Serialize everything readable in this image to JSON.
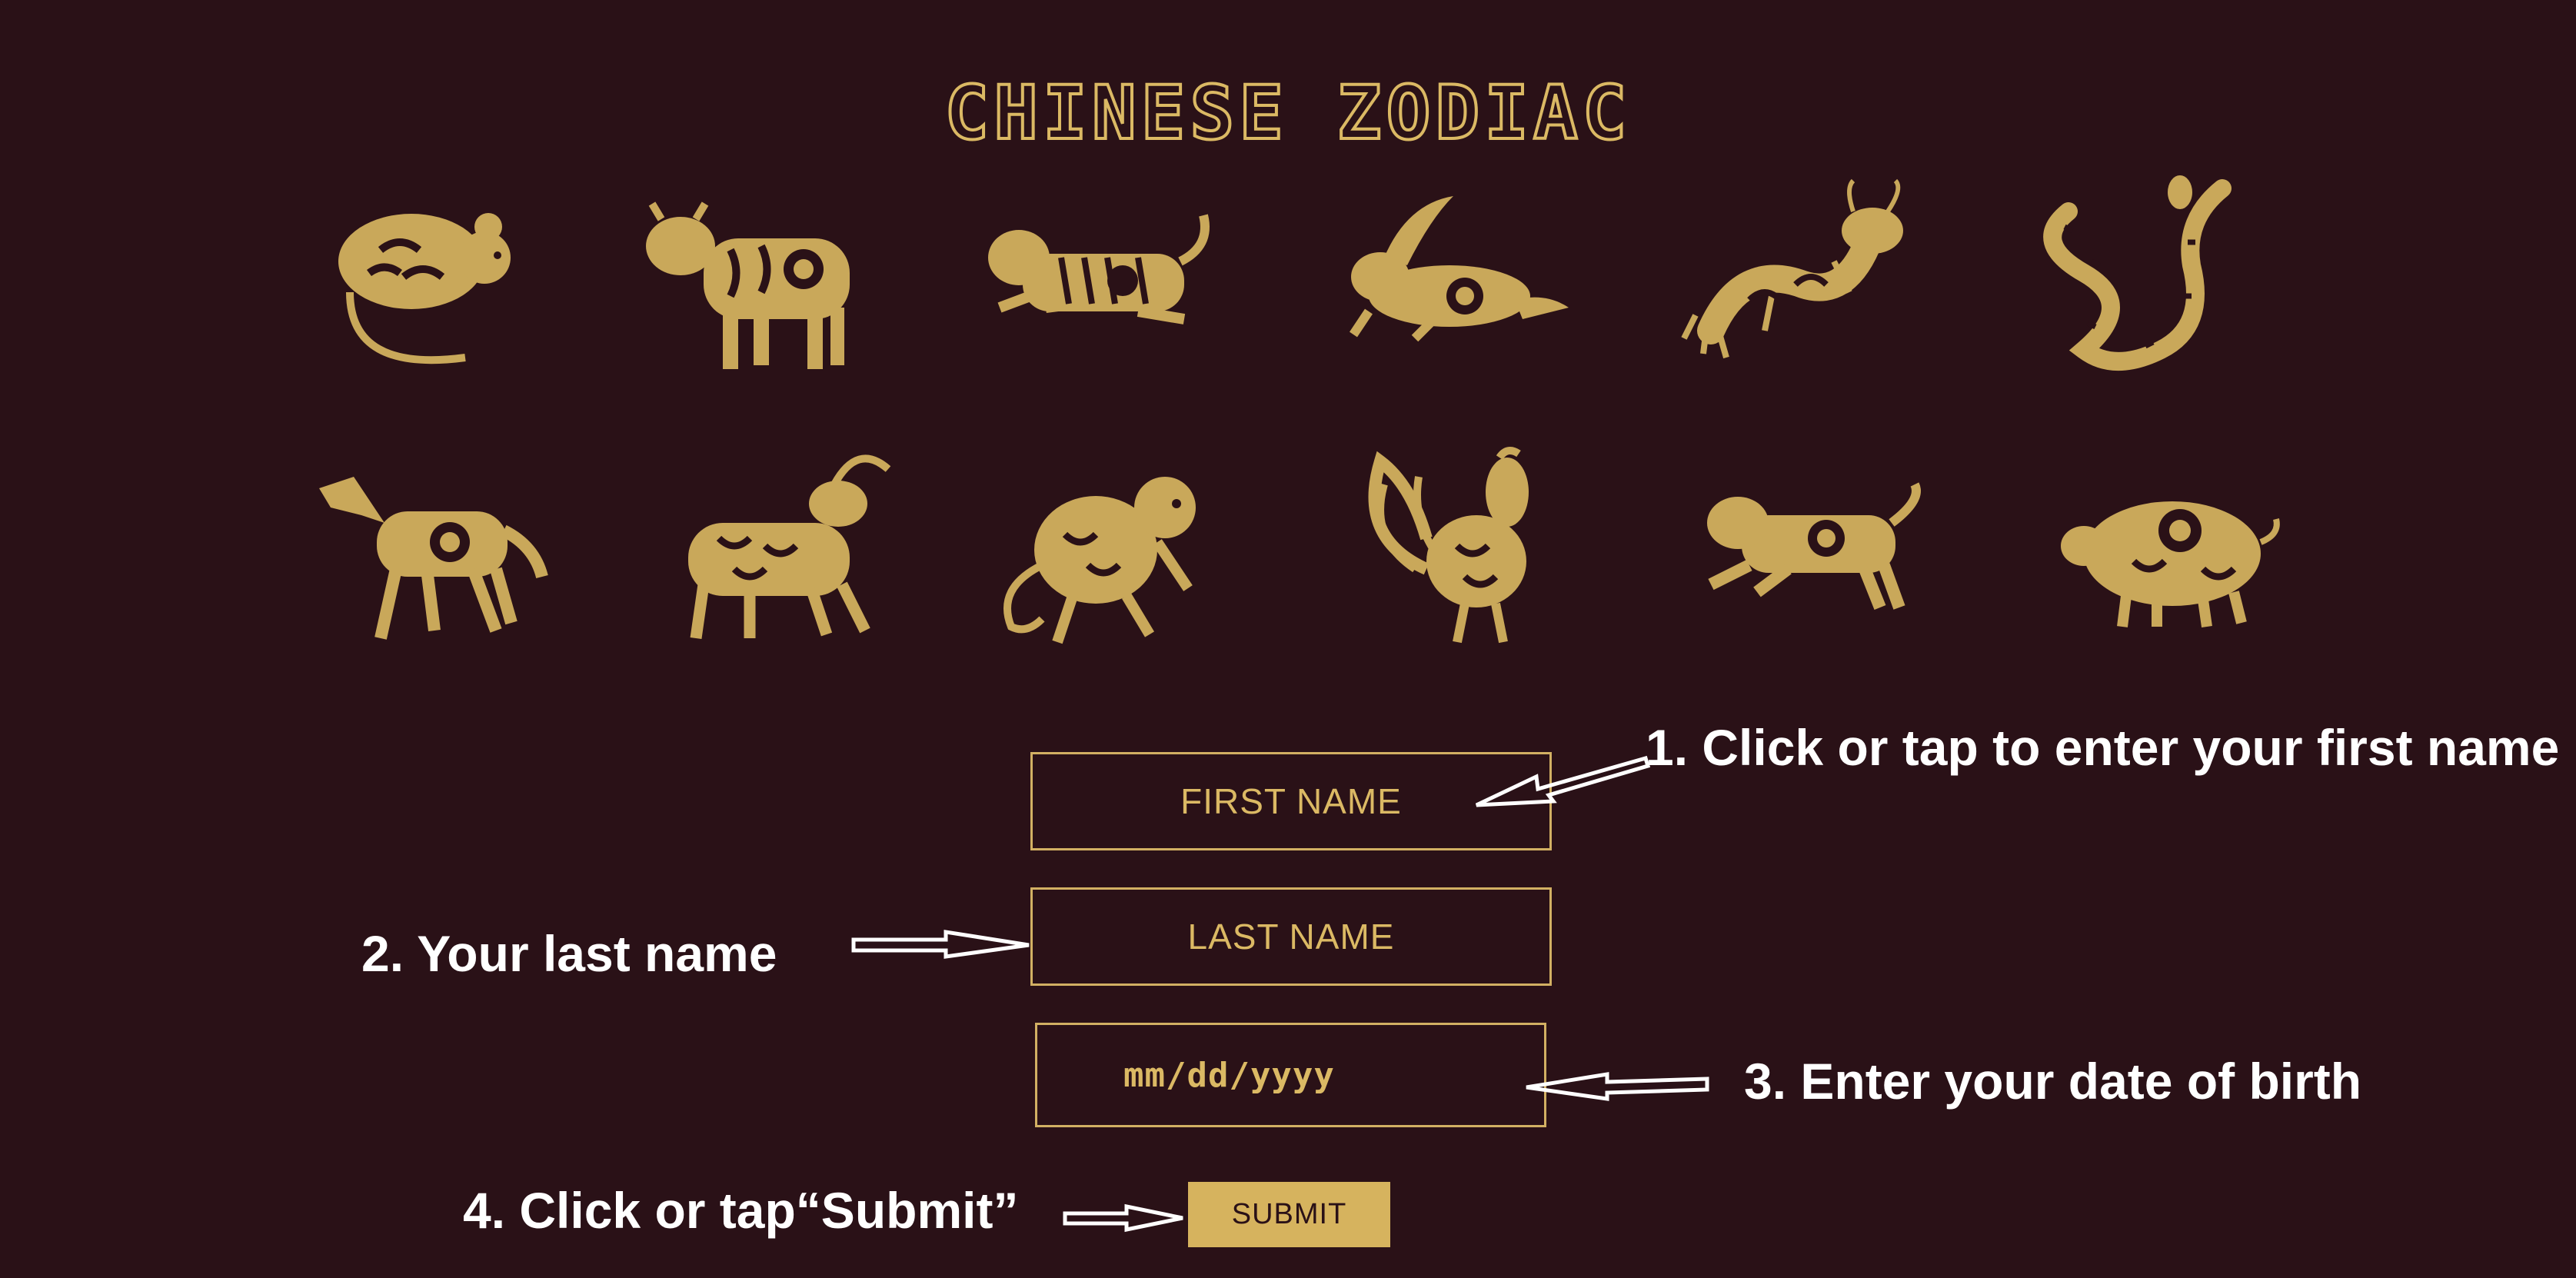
{
  "page": {
    "title": "CHINESE ZODIAC"
  },
  "animals": [
    {
      "name": "rat",
      "icon": "rat-icon"
    },
    {
      "name": "ox",
      "icon": "ox-icon"
    },
    {
      "name": "tiger",
      "icon": "tiger-icon"
    },
    {
      "name": "rabbit",
      "icon": "rabbit-icon"
    },
    {
      "name": "dragon",
      "icon": "dragon-icon"
    },
    {
      "name": "snake",
      "icon": "snake-icon"
    },
    {
      "name": "horse",
      "icon": "horse-icon"
    },
    {
      "name": "goat",
      "icon": "goat-icon"
    },
    {
      "name": "monkey",
      "icon": "monkey-icon"
    },
    {
      "name": "rooster",
      "icon": "rooster-icon"
    },
    {
      "name": "dog",
      "icon": "dog-icon"
    },
    {
      "name": "pig",
      "icon": "pig-icon"
    }
  ],
  "form": {
    "first_name_placeholder": "FIRST NAME",
    "last_name_placeholder": "LAST NAME",
    "date_placeholder": "mm/dd/yyyy",
    "submit_label": "SUBMIT"
  },
  "annotations": {
    "step1": "1. Click or tap to enter your first name",
    "step2": "2.  Your last name",
    "step3": "3. Enter your date of birth",
    "step4": "4. Click or tap“Submit”"
  },
  "colors": {
    "background": "#2a1117",
    "gold": "#dbb964",
    "annotation": "#ffffff"
  }
}
